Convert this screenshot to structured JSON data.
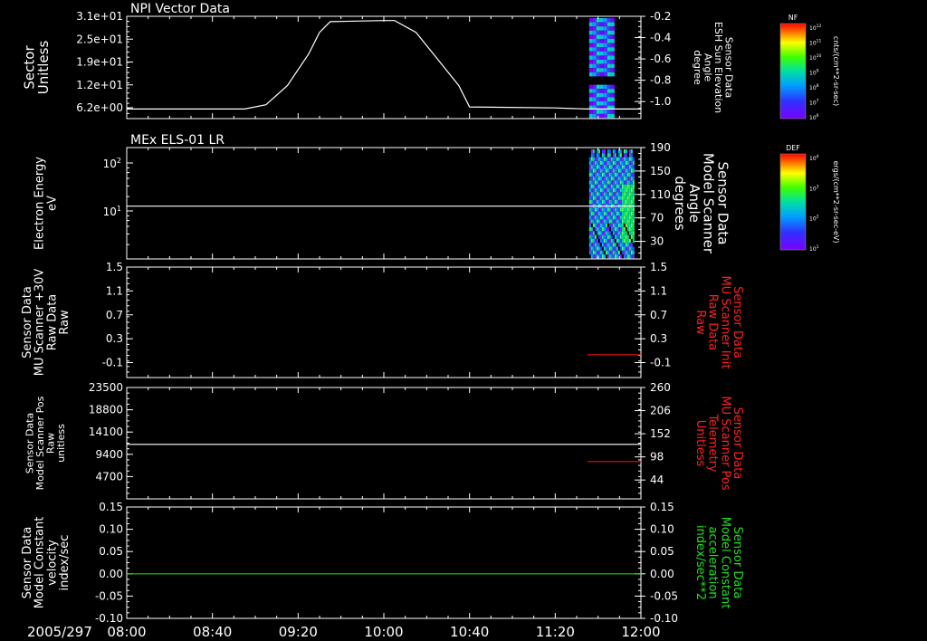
{
  "time_axis": {
    "date_label": "2005/297",
    "ticks": [
      "08:00",
      "08:40",
      "09:20",
      "10:00",
      "10:40",
      "11:20",
      "12:00"
    ]
  },
  "colorbars": [
    {
      "title": "NF",
      "unit_label": "cnts/(cm**2-sr-sec)",
      "ticks": [
        "10^12",
        "10^11",
        "10^10",
        "10^9",
        "10^8",
        "10^7",
        "10^6"
      ]
    },
    {
      "title": "DEF",
      "unit_label": "ergs/(cm**2-sr-sec-eV)",
      "ticks": [
        "10^4",
        "10^3",
        "10^2",
        "10^1"
      ]
    }
  ],
  "chart_data": [
    {
      "type": "heatmap",
      "title": "NPI Vector Data",
      "left_axis": {
        "label": [
          "Sector",
          "Unitless"
        ],
        "ticks": [
          "3.1e+01",
          "2.5e+01",
          "1.9e+01",
          "1.2e+01",
          "6.2e+00"
        ]
      },
      "right_axis": {
        "label": [
          "Sensor Data",
          "ESH Sun Elevation",
          "Angle",
          "degree"
        ],
        "ticks": [
          "-0.2",
          "-0.4",
          "-0.6",
          "-0.8",
          "-1.0"
        ],
        "ylim": [
          -1.16,
          -0.2
        ]
      },
      "colorbar": "NF",
      "line_series": [
        {
          "name": "ESH Sun Elevation Angle",
          "color": "#ffffff",
          "axis": "right",
          "x": [
            "08:00",
            "08:40",
            "08:55",
            "09:05",
            "09:15",
            "09:25",
            "09:30",
            "09:35",
            "10:00",
            "10:05",
            "10:15",
            "10:25",
            "10:35",
            "10:40",
            "11:20",
            "11:35",
            "12:00"
          ],
          "y": [
            -1.07,
            -1.07,
            -1.07,
            -1.03,
            -0.85,
            -0.55,
            -0.35,
            -0.25,
            -0.24,
            -0.24,
            -0.35,
            -0.6,
            -0.85,
            -1.05,
            -1.06,
            -1.07,
            -1.07
          ]
        }
      ]
    },
    {
      "type": "heatmap",
      "title": "MEx ELS-01 LR",
      "left_axis": {
        "label": [
          "Electron Energy",
          "eV"
        ],
        "ticks": [
          "10^2",
          "10^1"
        ],
        "scale": "log"
      },
      "right_axis": {
        "label": [
          "Sensor Data",
          "Model Scanner",
          "Angle",
          "degrees"
        ],
        "ticks": [
          "190",
          "150",
          "110",
          "70",
          "30"
        ],
        "ylim": [
          0,
          190
        ]
      },
      "colorbar": "DEF",
      "line_series": [
        {
          "name": "Model Scanner Angle",
          "color": "#ffffff",
          "axis": "right",
          "x": [
            "08:00",
            "12:00"
          ],
          "y": [
            90,
            90
          ]
        }
      ]
    },
    {
      "type": "line",
      "left_axis": {
        "label": [
          "Sensor Data",
          "MU Scanner +30V",
          "Raw Data",
          "Raw"
        ],
        "ticks": [
          "1.5",
          "1.1",
          "0.7",
          "0.3",
          "-0.1"
        ],
        "ylim": [
          -0.35,
          1.5
        ]
      },
      "right_axis": {
        "label": [
          "Sensor Data",
          "MU Scanner Init",
          "Raw Data",
          "Raw"
        ],
        "label_color": "#ff2020",
        "ticks": [
          "1.5",
          "1.1",
          "0.7",
          "0.3",
          "-0.1"
        ],
        "ylim": [
          -0.35,
          1.5
        ]
      },
      "series": [
        {
          "name": "MU Scanner Init Raw Data",
          "color": "#e01010",
          "axis": "right",
          "x": [
            "11:35",
            "12:00"
          ],
          "y": [
            0.03,
            0.03
          ]
        }
      ]
    },
    {
      "type": "line",
      "left_axis": {
        "label": [
          "Sensor Data",
          "Model Scanner Pos",
          "Raw",
          "unitless"
        ],
        "ticks": [
          "23500",
          "18800",
          "14100",
          "9400",
          "4700"
        ],
        "ylim": [
          0,
          23500
        ]
      },
      "right_axis": {
        "label": [
          "Sensor Data",
          "MU Scanner Pos",
          "Telemetry",
          "Unitless"
        ],
        "label_color": "#ff2020",
        "ticks": [
          "260",
          "206",
          "152",
          "98",
          "44"
        ],
        "ylim": [
          0,
          260
        ]
      },
      "series": [
        {
          "name": "Model Scanner Pos",
          "color": "#ffffff",
          "axis": "left",
          "x": [
            "08:00",
            "12:00"
          ],
          "y": [
            11500,
            11500
          ]
        },
        {
          "name": "MU Scanner Pos Telemetry",
          "color": "#e01010",
          "axis": "right",
          "x": [
            "11:35",
            "12:00"
          ],
          "y": [
            87,
            87
          ]
        }
      ]
    },
    {
      "type": "line",
      "left_axis": {
        "label": [
          "Sensor Data",
          "Model Constant",
          "velocity",
          "index/sec"
        ],
        "ticks": [
          "0.15",
          "0.10",
          "0.05",
          "0.00",
          "-0.05",
          "-0.10"
        ],
        "ylim": [
          -0.1,
          0.15
        ]
      },
      "right_axis": {
        "label": [
          "Sensor Data",
          "Model Constant",
          "acceleration",
          "index/sec**2"
        ],
        "label_color": "#20e020",
        "ticks": [
          "0.15",
          "0.10",
          "0.05",
          "0.00",
          "-0.05",
          "-0.10"
        ],
        "ylim": [
          -0.1,
          0.15
        ]
      },
      "series": [
        {
          "name": "Model Constant acceleration",
          "color": "#20d020",
          "axis": "right",
          "x": [
            "08:00",
            "12:00"
          ],
          "y": [
            0.0,
            0.0
          ]
        }
      ]
    }
  ]
}
